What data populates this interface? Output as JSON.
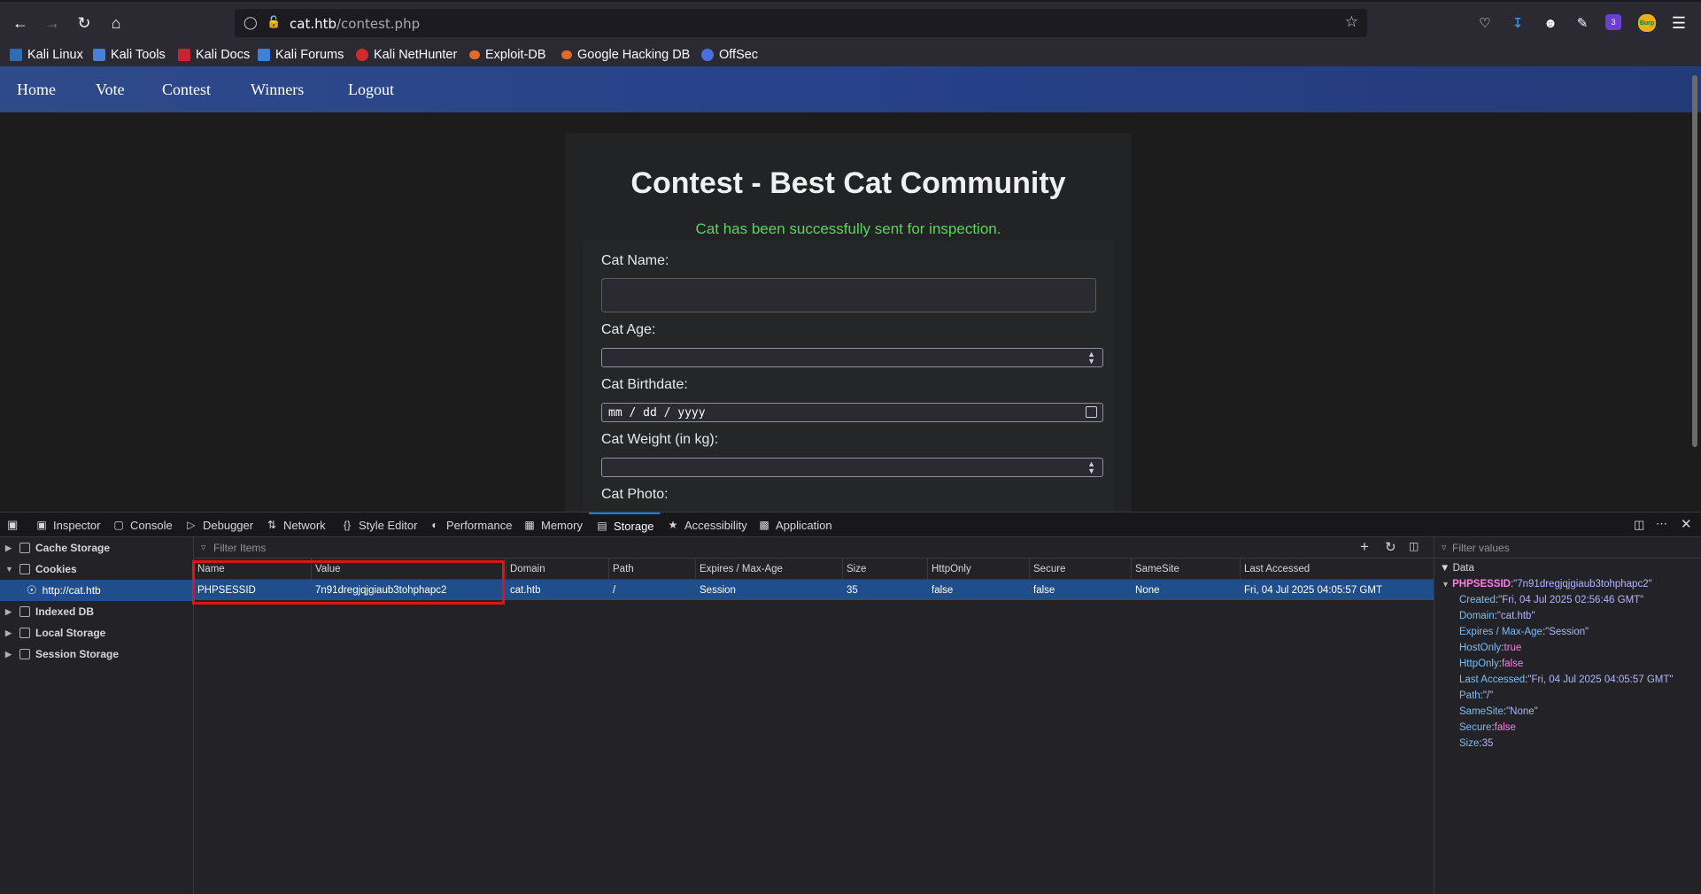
{
  "browser": {
    "url_host": "cat.htb",
    "url_path": "/contest.php",
    "bookmarks": [
      "Kali Linux",
      "Kali Tools",
      "Kali Docs",
      "Kali Forums",
      "Kali NetHunter",
      "Exploit-DB",
      "Google Hacking DB",
      "OffSec"
    ],
    "ext_badge": "3",
    "burp_badge": "Burp"
  },
  "site": {
    "nav": [
      "Home",
      "Vote",
      "Contest",
      "Winners",
      "Logout"
    ],
    "title": "Contest - Best Cat Community",
    "success": "Cat has been successfully sent for inspection.",
    "fields": {
      "name_label": "Cat Name:",
      "age_label": "Cat Age:",
      "birthdate_label": "Cat Birthdate:",
      "birthdate_placeholder": "mm / dd / yyyy",
      "weight_label": "Cat Weight (in kg):",
      "photo_label": "Cat Photo:"
    }
  },
  "devtools": {
    "tabs": [
      "Inspector",
      "Console",
      "Debugger",
      "Network",
      "Style Editor",
      "Performance",
      "Memory",
      "Storage",
      "Accessibility",
      "Application"
    ],
    "active_tab": "Storage",
    "sidebar": [
      "Cache Storage",
      "Cookies",
      "http://cat.htb",
      "Indexed DB",
      "Local Storage",
      "Session Storage"
    ],
    "filter_items_placeholder": "Filter Items",
    "filter_values_placeholder": "Filter values",
    "columns": [
      "Name",
      "Value",
      "Domain",
      "Path",
      "Expires / Max-Age",
      "Size",
      "HttpOnly",
      "Secure",
      "SameSite",
      "Last Accessed"
    ],
    "row": [
      "PHPSESSID",
      "7n91dregjqjgiaub3tohphapc2",
      "cat.htb",
      "/",
      "Session",
      "35",
      "false",
      "false",
      "None",
      "Fri, 04 Jul 2025 04:05:57 GMT"
    ],
    "data": {
      "header": "Data",
      "root_key": "PHPSESSID",
      "root_val": "\"7n91dregjqjgiaub3tohphapc2\"",
      "entries": [
        {
          "k": "Created",
          "v": "\"Fri, 04 Jul 2025 02:56:46 GMT\""
        },
        {
          "k": "Domain",
          "v": "\"cat.htb\""
        },
        {
          "k": "Expires / Max-Age",
          "v": "\"Session\""
        },
        {
          "k": "HostOnly",
          "v": "true"
        },
        {
          "k": "HttpOnly",
          "v": "false"
        },
        {
          "k": "Last Accessed",
          "v": "\"Fri, 04 Jul 2025 04:05:57 GMT\""
        },
        {
          "k": "Path",
          "v": "\"/\""
        },
        {
          "k": "SameSite",
          "v": "\"None\""
        },
        {
          "k": "Secure",
          "v": "false"
        },
        {
          "k": "Size",
          "v": "35"
        }
      ]
    }
  }
}
